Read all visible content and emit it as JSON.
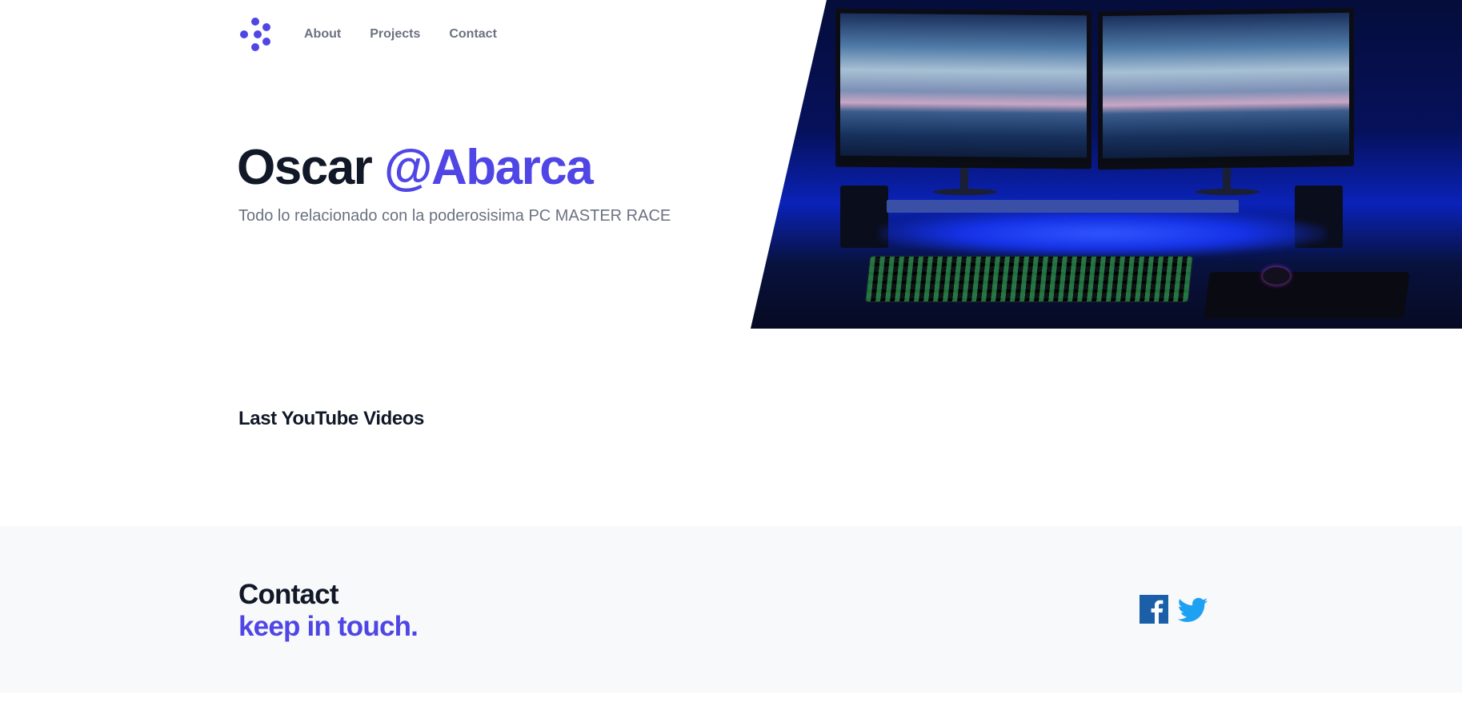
{
  "nav": {
    "logo_icon": "dots-chevron-logo-icon",
    "links": [
      {
        "label": "About"
      },
      {
        "label": "Projects"
      },
      {
        "label": "Contact"
      }
    ]
  },
  "hero": {
    "title_name": "Oscar ",
    "title_handle": "@Abarca",
    "subtitle": "Todo lo relacionado con la poderosisima PC MASTER RACE",
    "image_subject": "dual-monitor-gaming-setup-photo"
  },
  "videos": {
    "heading": "Last YouTube Videos"
  },
  "contact": {
    "title": "Contact",
    "subtitle": "keep in touch.",
    "social": [
      {
        "icon": "facebook-icon"
      },
      {
        "icon": "twitter-icon"
      }
    ]
  },
  "colors": {
    "accent": "#4f46e5",
    "heading": "#111827",
    "muted": "#6b7280",
    "footer_bg": "#f8f9fb",
    "facebook": "#1a5fa8",
    "twitter": "#1da1f2"
  }
}
